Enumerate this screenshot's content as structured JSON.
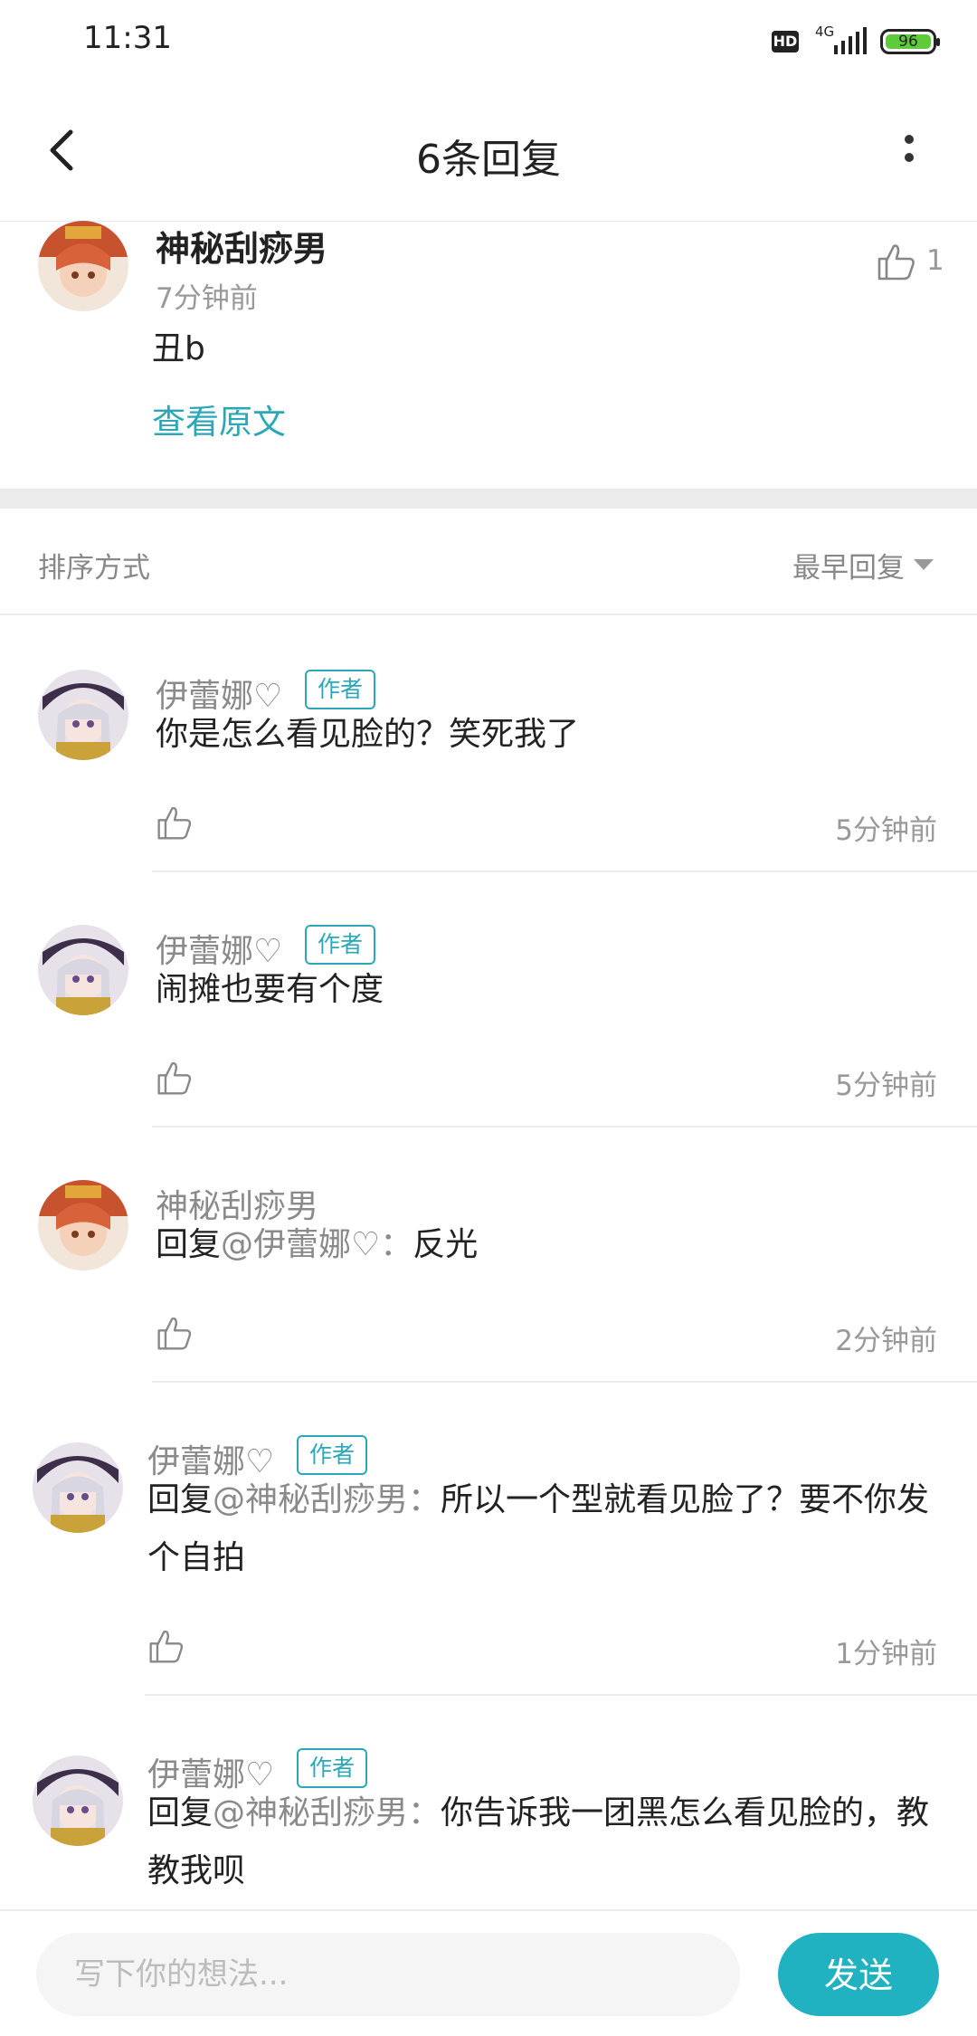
{
  "status_bar": {
    "time": "11:31",
    "hd": "HD",
    "network": "4G",
    "battery": "96"
  },
  "header": {
    "title": "6条回复",
    "back_icon": "chevron-left-icon",
    "more_icon": "more-vertical-icon"
  },
  "main_comment": {
    "author": "神秘刮痧男",
    "time": "7分钟前",
    "text": "丑b",
    "view_original": "查看原文",
    "like_count": "1"
  },
  "sort": {
    "label": "排序方式",
    "value": "最早回复"
  },
  "replies": [
    {
      "author": "伊蕾娜♡",
      "badge": "作者",
      "prefix": "",
      "mention": "",
      "text": "你是怎么看见脸的？笑死我了",
      "time": "5分钟前"
    },
    {
      "author": "伊蕾娜♡",
      "badge": "作者",
      "prefix": "",
      "mention": "",
      "text": "闹摊也要有个度",
      "time": "5分钟前"
    },
    {
      "author": "神秘刮痧男",
      "badge": "",
      "prefix": "回复",
      "mention": "@伊蕾娜♡：",
      "text": "反光",
      "time": "2分钟前"
    },
    {
      "author": "伊蕾娜♡",
      "badge": "作者",
      "prefix": "回复",
      "mention": "@神秘刮痧男：",
      "text": "所以一个型就看见脸了？要不你发个自拍",
      "time": "1分钟前"
    },
    {
      "author": "伊蕾娜♡",
      "badge": "作者",
      "prefix": "回复",
      "mention": "@神秘刮痧男：",
      "text": "你告诉我一团黑怎么看见脸的，教教我呗",
      "time": ""
    }
  ],
  "input": {
    "placeholder": "写下你的想法...",
    "send_label": "发送"
  },
  "colors": {
    "accent": "#21b2c2",
    "link": "#2aa8b8",
    "muted": "#999999"
  }
}
